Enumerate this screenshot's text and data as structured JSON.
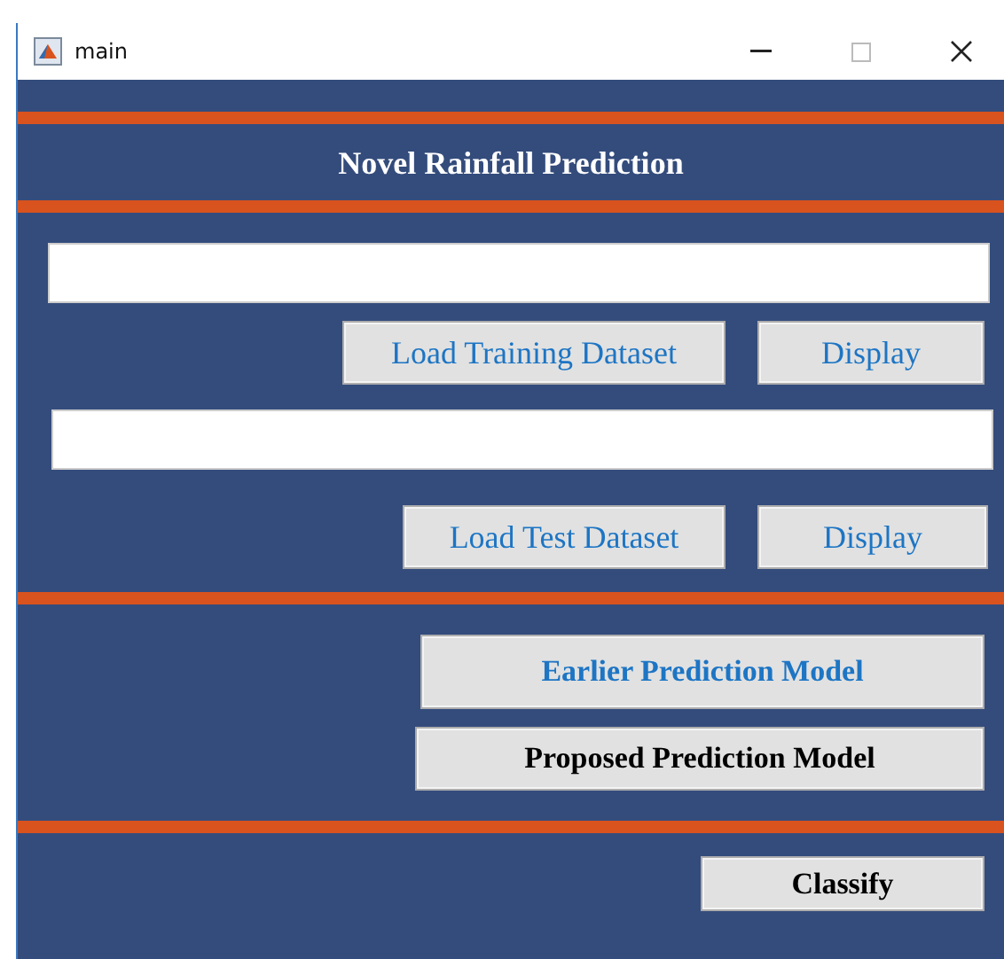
{
  "window": {
    "title": "main"
  },
  "heading": "Novel Rainfall Prediction",
  "sections": [
    {
      "rows": [
        {
          "kind": "field",
          "buttons": [
            {
              "label": "Load Training Dataset",
              "kind": "plain"
            },
            {
              "label": "Display",
              "kind": "plain"
            }
          ]
        },
        {
          "kind": "field",
          "buttons": [
            {
              "label": "Load Test Dataset",
              "kind": "plain"
            },
            {
              "label": "Display",
              "kind": "plain"
            }
          ]
        }
      ]
    },
    {
      "rows": [
        {
          "kind": "buttons",
          "buttons": [
            {
              "label": "Earlier Prediction Model",
              "kind": "accent"
            }
          ]
        },
        {
          "kind": "buttons",
          "buttons": [
            {
              "label": "Proposed Prediction Model",
              "kind": "strong"
            }
          ]
        }
      ]
    },
    {
      "rows": [
        {
          "kind": "buttons",
          "buttons": [
            {
              "label": "Classify",
              "kind": "strong"
            }
          ]
        }
      ]
    }
  ]
}
